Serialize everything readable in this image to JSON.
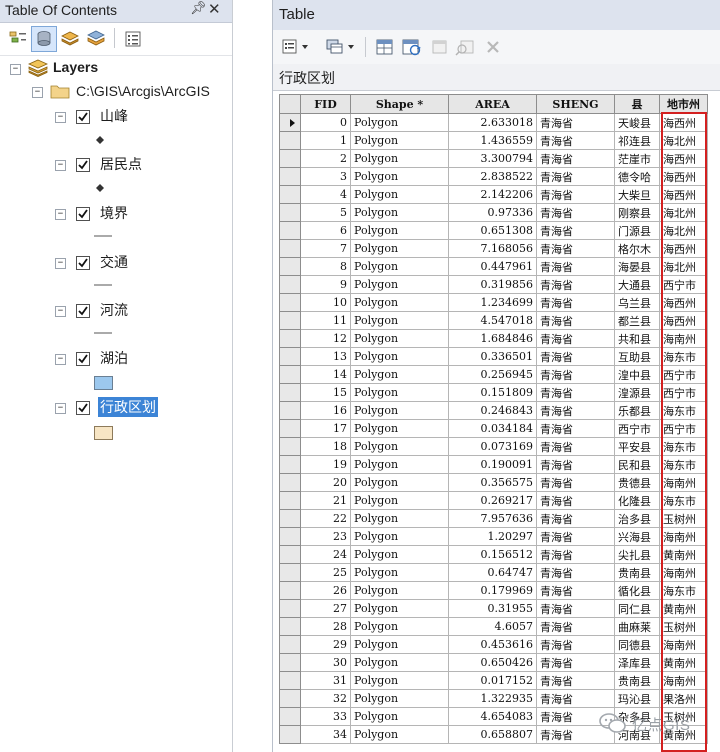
{
  "toc": {
    "title": "Table Of Contents",
    "pin_icon": "pin-icon",
    "close_icon": "close-icon",
    "root_label": "Layers",
    "path_label": "C:\\GIS\\Arcgis\\ArcGIS",
    "layers": [
      {
        "name": "山峰",
        "symbol": "point"
      },
      {
        "name": "居民点",
        "symbol": "point"
      },
      {
        "name": "境界",
        "symbol": "line"
      },
      {
        "name": "交通",
        "symbol": "line"
      },
      {
        "name": "河流",
        "symbol": "line"
      },
      {
        "name": "湖泊",
        "symbol": "fill-blue",
        "color": "#9cc8ee"
      },
      {
        "name": "行政区划",
        "symbol": "fill-tan",
        "color": "#f7e5c4",
        "selected": true
      }
    ],
    "collapse_sign": "−"
  },
  "table": {
    "window_title": "Table",
    "tab_label": "行政区划",
    "columns": [
      "FID",
      "Shape *",
      "AREA",
      "SHENG",
      "县",
      "地市州"
    ],
    "rows": [
      [
        "0",
        "Polygon",
        "2.633018",
        "青海省",
        "天峻县",
        "海西州"
      ],
      [
        "1",
        "Polygon",
        "1.436559",
        "青海省",
        "祁连县",
        "海北州"
      ],
      [
        "2",
        "Polygon",
        "3.300794",
        "青海省",
        "茫崖市",
        "海西州"
      ],
      [
        "3",
        "Polygon",
        "2.838522",
        "青海省",
        "德令哈",
        "海西州"
      ],
      [
        "4",
        "Polygon",
        "2.142206",
        "青海省",
        "大柴旦",
        "海西州"
      ],
      [
        "5",
        "Polygon",
        "0.97336",
        "青海省",
        "刚察县",
        "海北州"
      ],
      [
        "6",
        "Polygon",
        "0.651308",
        "青海省",
        "门源县",
        "海北州"
      ],
      [
        "7",
        "Polygon",
        "7.168056",
        "青海省",
        "格尔木",
        "海西州"
      ],
      [
        "8",
        "Polygon",
        "0.447961",
        "青海省",
        "海晏县",
        "海北州"
      ],
      [
        "9",
        "Polygon",
        "0.319856",
        "青海省",
        "大通县",
        "西宁市"
      ],
      [
        "10",
        "Polygon",
        "1.234699",
        "青海省",
        "乌兰县",
        "海西州"
      ],
      [
        "11",
        "Polygon",
        "4.547018",
        "青海省",
        "都兰县",
        "海西州"
      ],
      [
        "12",
        "Polygon",
        "1.684846",
        "青海省",
        "共和县",
        "海南州"
      ],
      [
        "13",
        "Polygon",
        "0.336501",
        "青海省",
        "互助县",
        "海东市"
      ],
      [
        "14",
        "Polygon",
        "0.256945",
        "青海省",
        "湟中县",
        "西宁市"
      ],
      [
        "15",
        "Polygon",
        "0.151809",
        "青海省",
        "湟源县",
        "西宁市"
      ],
      [
        "16",
        "Polygon",
        "0.246843",
        "青海省",
        "乐都县",
        "海东市"
      ],
      [
        "17",
        "Polygon",
        "0.034184",
        "青海省",
        "西宁市",
        "西宁市"
      ],
      [
        "18",
        "Polygon",
        "0.073169",
        "青海省",
        "平安县",
        "海东市"
      ],
      [
        "19",
        "Polygon",
        "0.190091",
        "青海省",
        "民和县",
        "海东市"
      ],
      [
        "20",
        "Polygon",
        "0.356575",
        "青海省",
        "贵德县",
        "海南州"
      ],
      [
        "21",
        "Polygon",
        "0.269217",
        "青海省",
        "化隆县",
        "海东市"
      ],
      [
        "22",
        "Polygon",
        "7.957636",
        "青海省",
        "治多县",
        "玉树州"
      ],
      [
        "23",
        "Polygon",
        "1.20297",
        "青海省",
        "兴海县",
        "海南州"
      ],
      [
        "24",
        "Polygon",
        "0.156512",
        "青海省",
        "尖扎县",
        "黄南州"
      ],
      [
        "25",
        "Polygon",
        "0.64747",
        "青海省",
        "贵南县",
        "海南州"
      ],
      [
        "26",
        "Polygon",
        "0.179969",
        "青海省",
        "循化县",
        "海东市"
      ],
      [
        "27",
        "Polygon",
        "0.31955",
        "青海省",
        "同仁县",
        "黄南州"
      ],
      [
        "28",
        "Polygon",
        "4.6057",
        "青海省",
        "曲麻莱",
        "玉树州"
      ],
      [
        "29",
        "Polygon",
        "0.453616",
        "青海省",
        "同德县",
        "海南州"
      ],
      [
        "30",
        "Polygon",
        "0.650426",
        "青海省",
        "泽库县",
        "黄南州"
      ],
      [
        "31",
        "Polygon",
        "0.017152",
        "青海省",
        "贵南县",
        "海南州"
      ],
      [
        "32",
        "Polygon",
        "1.322935",
        "青海省",
        "玛沁县",
        "果洛州"
      ],
      [
        "33",
        "Polygon",
        "4.654083",
        "青海省",
        "杂多县",
        "玉树州"
      ],
      [
        "34",
        "Polygon",
        "0.658807",
        "青海省",
        "河南县",
        "黄南州"
      ]
    ]
  },
  "watermark": {
    "text": "亿点GIS"
  }
}
